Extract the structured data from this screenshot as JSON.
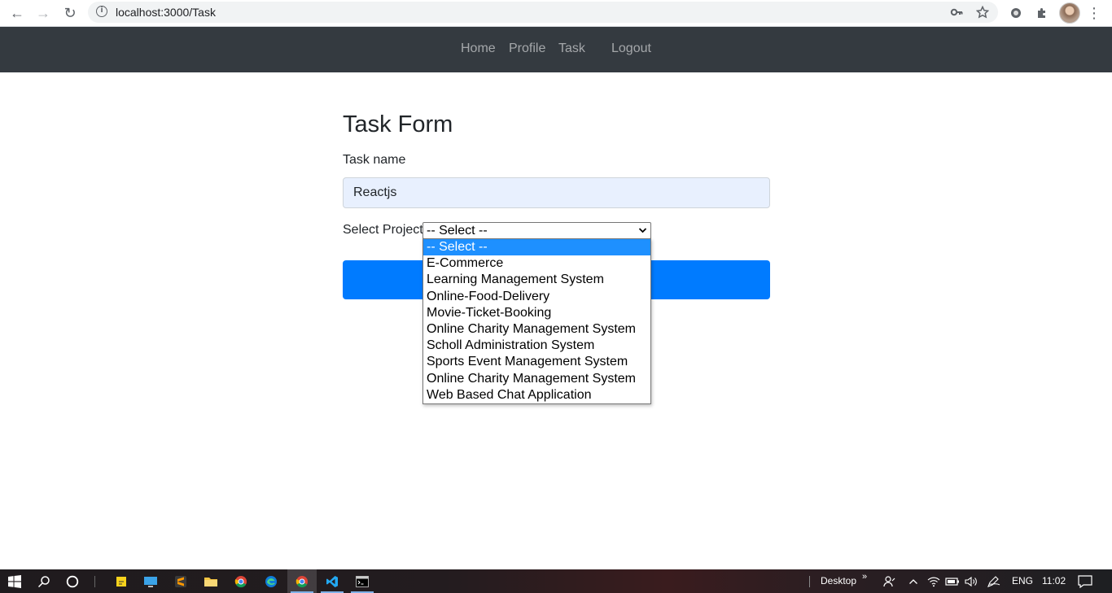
{
  "browser": {
    "url": "localhost:3000/Task",
    "back_icon": "←",
    "forward_icon": "→",
    "reload_icon": "↻",
    "menu_icon": "⋮"
  },
  "navbar": {
    "links": [
      "Home",
      "Profile",
      "Task",
      "Logout"
    ]
  },
  "form": {
    "title": "Task Form",
    "task_name_label": "Task name",
    "task_name_value": "Reactjs",
    "project_label": "Select Project",
    "project_selected": "-- Select --",
    "project_options": [
      "-- Select --",
      "E-Commerce",
      "Learning Management System",
      "Online-Food-Delivery",
      "Movie-Ticket-Booking",
      "Online Charity Management System",
      "Scholl Administration System",
      "Sports Event Management System",
      "Online Charity Management System",
      "Web Based Chat Application"
    ],
    "submit_color": "#007bff"
  },
  "taskbar": {
    "desktop_label": "Desktop",
    "language": "ENG",
    "time": "11:02"
  },
  "colors": {
    "navbar_bg": "#343a40",
    "selected_option": "#1e90ff",
    "input_bg": "#e8f0fe"
  }
}
